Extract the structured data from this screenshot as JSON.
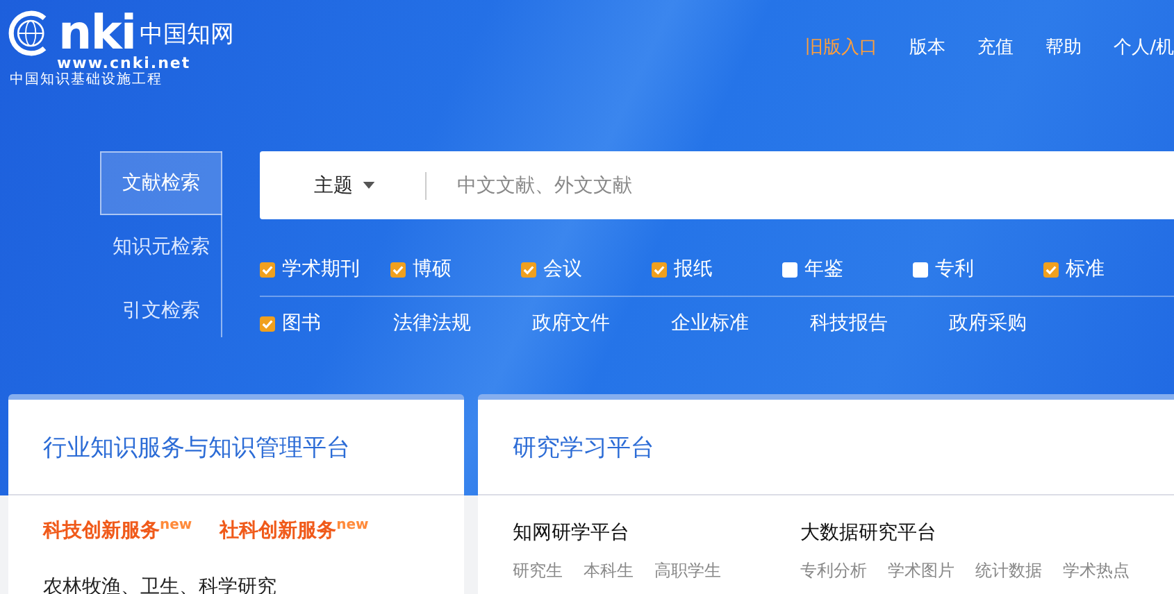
{
  "logo": {
    "mark": "nki",
    "name": "中国知网",
    "url": "www.cnki.net",
    "slogan": "中国知识基础设施工程"
  },
  "top_nav": [
    {
      "label": "旧版入口",
      "highlight": true
    },
    {
      "label": "版本",
      "highlight": false
    },
    {
      "label": "充值",
      "highlight": false
    },
    {
      "label": "帮助",
      "highlight": false
    },
    {
      "label": "个人/机",
      "highlight": false
    }
  ],
  "search_tabs": [
    {
      "label": "文献检索",
      "selected": true
    },
    {
      "label": "知识元检索",
      "selected": false
    },
    {
      "label": "引文检索",
      "selected": false
    }
  ],
  "search": {
    "field_selector": "主题",
    "placeholder": "中文文献、外文文献"
  },
  "resource_rows": [
    [
      {
        "kind": "checkbox",
        "label": "学术期刊",
        "checked": true
      },
      {
        "kind": "checkbox",
        "label": "博硕",
        "checked": true
      },
      {
        "kind": "checkbox",
        "label": "会议",
        "checked": true
      },
      {
        "kind": "checkbox",
        "label": "报纸",
        "checked": true
      },
      {
        "kind": "checkbox",
        "label": "年鉴",
        "checked": false
      },
      {
        "kind": "checkbox",
        "label": "专利",
        "checked": false
      },
      {
        "kind": "checkbox",
        "label": "标准",
        "checked": true
      }
    ],
    [
      {
        "kind": "checkbox",
        "label": "图书",
        "checked": true
      },
      {
        "kind": "link",
        "label": "法律法规"
      },
      {
        "kind": "link",
        "label": "政府文件"
      },
      {
        "kind": "link",
        "label": "企业标准"
      },
      {
        "kind": "link",
        "label": "科技报告"
      },
      {
        "kind": "link",
        "label": "政府采购"
      }
    ]
  ],
  "cards": [
    {
      "title": "行业知识服务与知识管理平台",
      "kind": "services",
      "services": [
        "科技创新服务$^{new}$",
        "社科创新服务$^{new}$"
      ],
      "text": "农林牧渔、卫生、科学研究"
    },
    {
      "title": "研究学习平台",
      "kind": "platforms",
      "platforms": [
        {
          "name": "知网研学平台",
          "links": [
            "研究生",
            "本科生",
            "高职学生"
          ]
        },
        {
          "name": "大数据研究平台",
          "links": [
            "专利分析",
            "学术图片",
            "统计数据",
            "学术热点"
          ]
        }
      ]
    }
  ]
}
